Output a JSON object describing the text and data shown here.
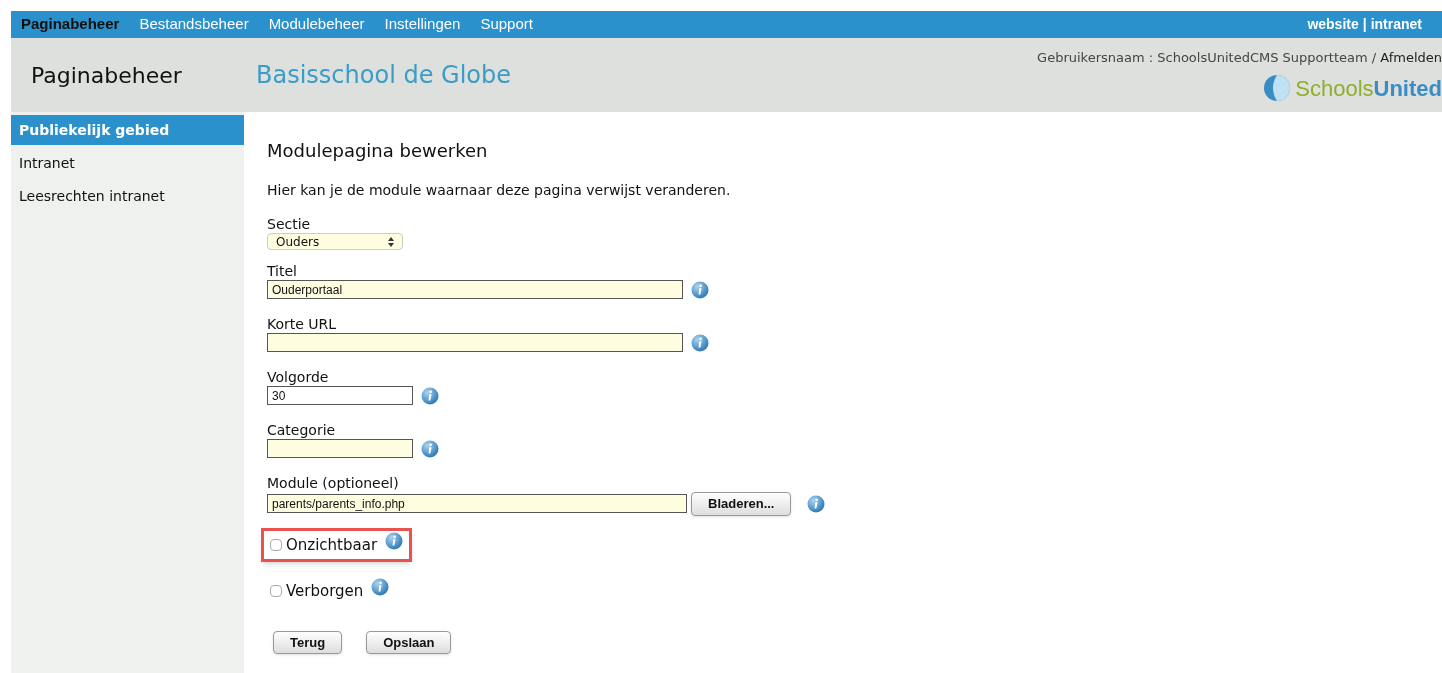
{
  "top_menu": [
    {
      "label": "Paginabeheer",
      "selected": true
    },
    {
      "label": "Bestandsbeheer",
      "selected": false
    },
    {
      "label": "Modulebeheer",
      "selected": false
    },
    {
      "label": "Instellingen",
      "selected": false
    },
    {
      "label": "Support",
      "selected": false
    }
  ],
  "top_links": [
    "website",
    "|",
    "intranet"
  ],
  "header": {
    "section_title": "Paginabeheer",
    "site_title": "Basisschool de Globe",
    "user_label": "Gebruikersnaam : SchoolsUnitedCMS Supportteam /",
    "logout": "Afmelden",
    "logo_left": "Schools",
    "logo_right": "United"
  },
  "sidebar": {
    "items": [
      {
        "label": "Publiekelijk gebied",
        "selected": true
      },
      {
        "label": "Intranet",
        "selected": false
      },
      {
        "label": "Leesrechten intranet",
        "selected": false
      }
    ]
  },
  "form": {
    "title": "Modulepagina bewerken",
    "intro": "Hier kan je de module waarnaar deze pagina verwijst veranderen.",
    "fields": [
      {
        "kind": "select",
        "label": "Sectie",
        "value": "Ouders",
        "info": false
      },
      {
        "kind": "long",
        "label": "Titel",
        "value": "Ouderportaal",
        "info": true
      },
      {
        "kind": "long",
        "label": "Korte URL",
        "info": true
      },
      {
        "kind": "short",
        "label": "Volgorde",
        "value": "30",
        "info": true,
        "highlight_input": false
      },
      {
        "kind": "short",
        "label": "Categorie",
        "info": true,
        "highlight_input": true
      },
      {
        "kind": "browse",
        "label": "Module (optioneel)",
        "value": "parents/parents_info.php",
        "button": "Bladeren...",
        "info": true
      },
      {
        "kind": "checkbox",
        "label": "Onzichtbaar",
        "checked": false,
        "highlighted": true,
        "info": true
      },
      {
        "kind": "checkbox",
        "label": "Verborgen",
        "checked": false,
        "highlighted": false,
        "info": true
      }
    ],
    "buttons": [
      "Terug",
      "Opslaan"
    ]
  }
}
